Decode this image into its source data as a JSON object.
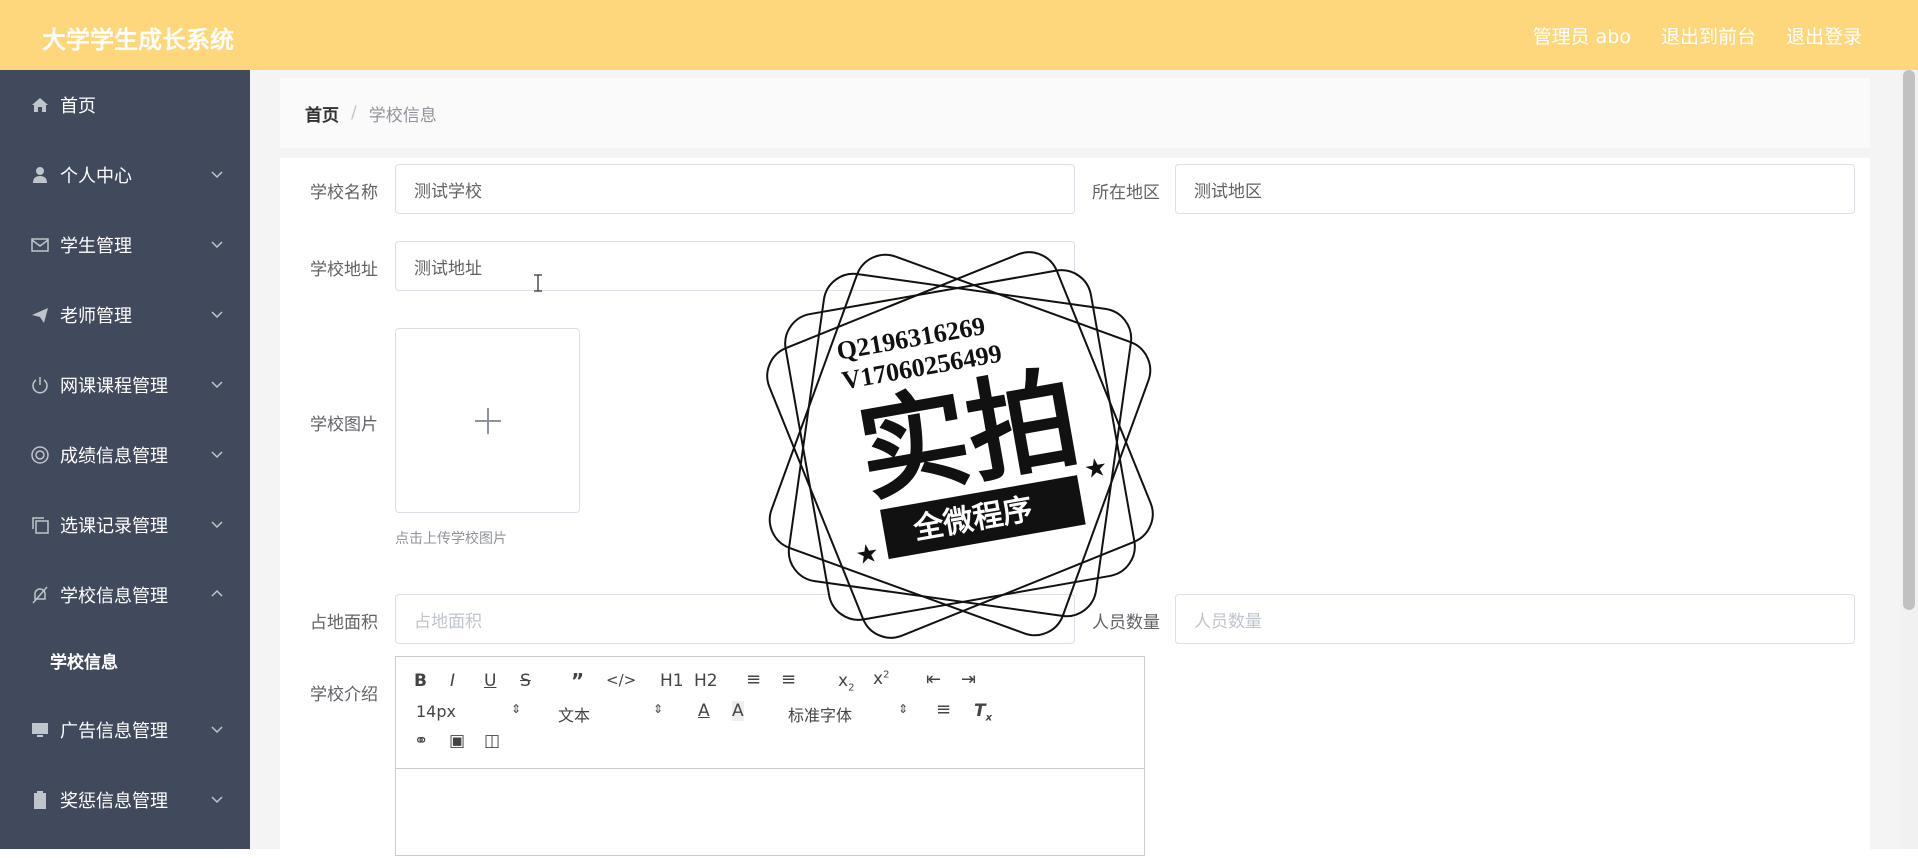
{
  "app": {
    "title": "大学学生成长系统"
  },
  "topnav": {
    "user": "管理员 abo",
    "front": "退出到前台",
    "logout": "退出登录"
  },
  "sidebar": {
    "items": [
      {
        "label": "首页",
        "icon": "home-icon"
      },
      {
        "label": "个人中心",
        "icon": "user-icon"
      },
      {
        "label": "学生管理",
        "icon": "mail-icon"
      },
      {
        "label": "老师管理",
        "icon": "send-icon"
      },
      {
        "label": "网课课程管理",
        "icon": "power-icon"
      },
      {
        "label": "成绩信息管理",
        "icon": "lifebuoy-icon"
      },
      {
        "label": "选课记录管理",
        "icon": "copy-icon"
      },
      {
        "label": "学校信息管理",
        "icon": "bell-off-icon"
      },
      {
        "label": "广告信息管理",
        "icon": "monitor-icon"
      },
      {
        "label": "奖惩信息管理",
        "icon": "clipboard-icon"
      }
    ],
    "active_sub": "学校信息"
  },
  "breadcrumb": {
    "home": "首页",
    "separator": "/",
    "current": "学校信息"
  },
  "form": {
    "school_name": {
      "label": "学校名称",
      "value": "测试学校"
    },
    "region": {
      "label": "所在地区",
      "value": "测试地区"
    },
    "address": {
      "label": "学校地址",
      "value": "测试地址"
    },
    "image": {
      "label": "学校图片",
      "hint": "点击上传学校图片"
    },
    "area": {
      "label": "占地面积",
      "placeholder": "占地面积"
    },
    "population": {
      "label": "人员数量",
      "placeholder": "人员数量"
    },
    "intro": {
      "label": "学校介绍"
    }
  },
  "editor": {
    "font_size": "14px",
    "header": "文本",
    "font": "标准字体",
    "h1": "H1",
    "h2": "H2"
  },
  "watermark": {
    "line1": "Q2196316269",
    "line2": "V17060256499",
    "main": "实拍",
    "banner": "全微程序"
  }
}
